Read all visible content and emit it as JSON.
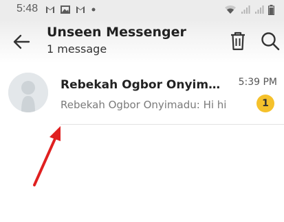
{
  "status_bar": {
    "time": "5:48",
    "icons_left": [
      "gmail-icon",
      "image-icon",
      "gmail-icon",
      "dot-icon"
    ],
    "icons_right": [
      "wifi-icon",
      "signal-icon",
      "signal-icon",
      "battery-icon"
    ]
  },
  "app_bar": {
    "title": "Unseen Messenger",
    "subtitle": "1 message",
    "icons": [
      "back-arrow-icon",
      "trash-icon",
      "search-icon"
    ]
  },
  "conversation": {
    "name": "Rebekah Ogbor Onyim…",
    "preview": "Rebekah Ogbor Onyimadu: Hi hi",
    "time": "5:39 PM",
    "unread_count": "1",
    "badge_color": "#f5c12b"
  },
  "annotation": {
    "arrow_color": "#e02020"
  }
}
